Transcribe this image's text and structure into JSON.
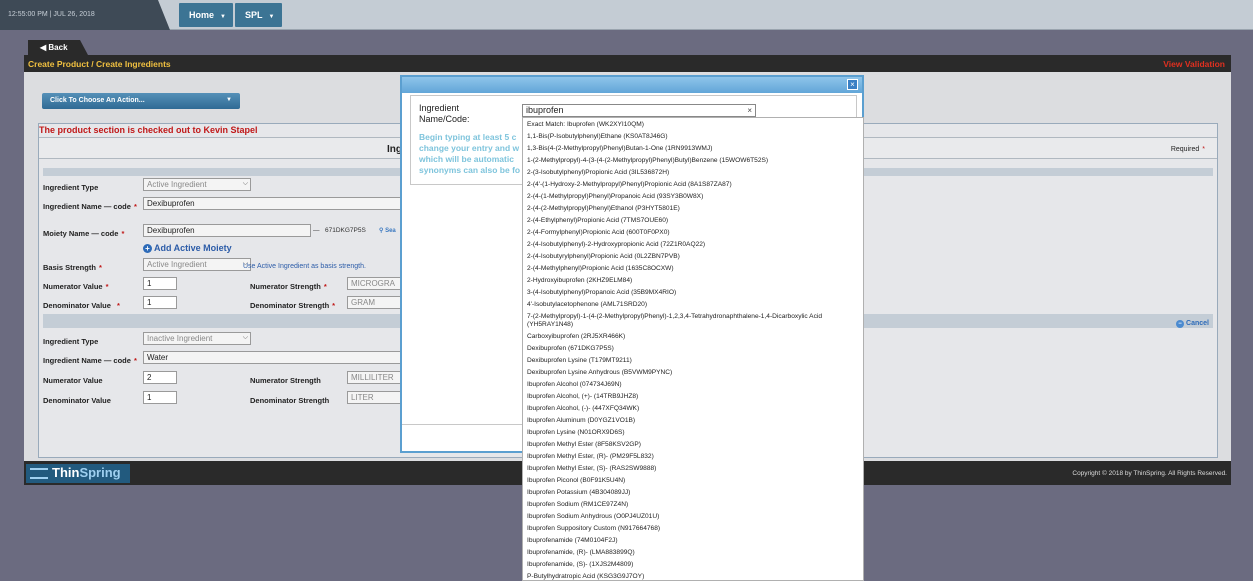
{
  "topbar": {
    "datetime": "12:55:00 PM | JUL 26, 2018",
    "nav": [
      {
        "label": "Home"
      },
      {
        "label": "SPL"
      }
    ]
  },
  "back_label": "Back",
  "breadcrumb": {
    "text": "Create Product  /  Create Ingredients"
  },
  "view_validation": "View Validation",
  "action_select": {
    "label": "Click To Choose An Action..."
  },
  "checked_out_msg": "The product section is checked out to Kevin Stapel",
  "form": {
    "title_fragment": "Ing",
    "required_label": "Required",
    "active": {
      "type_label": "Ingredient Type",
      "type_value": "Active Ingredient",
      "name_label": "Ingredient Name — code",
      "name_value": "Dexibuprofen",
      "moiety_label": "Moiety Name — code",
      "moiety_value": "Dexibuprofen",
      "moiety_code": "671DKG7P5S",
      "search_link": "Sea",
      "add_moiety": "Add Active Moiety",
      "basis_label": "Basis Strength",
      "basis_value": "Active Ingredient",
      "basis_note": "Use Active Ingredient as basis strength.",
      "num_value_label": "Numerator Value",
      "num_value": "1",
      "num_strength_label": "Numerator Strength",
      "num_strength": "MICROGRA",
      "den_value_label": "Denominator Value",
      "den_value": "1",
      "den_strength_label": "Denominator Strength",
      "den_strength": "GRAM"
    },
    "cancel_label": "Cancel",
    "inactive": {
      "type_label": "Ingredient Type",
      "type_value": "Inactive Ingredient",
      "name_label": "Ingredient Name — code",
      "name_value": "Water",
      "num_value_label": "Numerator Value",
      "num_value": "2",
      "num_strength_label": "Numerator Strength",
      "num_strength": "MILLILITER",
      "den_value_label": "Denominator Value",
      "den_value": "1",
      "den_strength_label": "Denominator Strength",
      "den_strength": "LITER"
    }
  },
  "footer": {
    "logo_thin": "Thin",
    "logo_spring": "Spring",
    "copyright": "Copyright © 2018 by ThinSpring. All Rights Reserved."
  },
  "modal": {
    "ingredient_label_1": "Ingredient",
    "ingredient_label_2": "Name/Code:",
    "hint_1": "Begin typing at least 5 c",
    "hint_2": "change your entry and w",
    "hint_3": "which will be automatic",
    "hint_4": "synonyms can also be fo",
    "search_value": "ibuprofen",
    "suggestions": [
      "Exact Match: Ibuprofen (WK2XYI10QM)",
      "1,1-Bis(P-Isobutylphenyl)Ethane (KS0AT8J46G)",
      "1,3-Bis(4-(2-Methylpropyl)Phenyl)Butan-1-One (1RN9913WMJ)",
      "1-(2-Methylpropyl)-4-(3-(4-(2-Methylpropyl)Phenyl)Butyl)Benzene (15WOW6T52S)",
      "2-(3-Isobutylphenyl)Propionic Acid (3IL536872H)",
      "2-(4'-(1-Hydroxy-2-Methylpropyl)Phenyl)Propionic Acid (8A1S87ZA87)",
      "2-(4-(1-Methylpropyl)Phenyl)Propanoic Acid (93SY3B0W8X)",
      "2-(4-(2-Methylpropyl)Phenyl)Ethanol (P3HYT5801E)",
      "2-(4-Ethylphenyl)Propionic Acid (7TMS7OUE60)",
      "2-(4-Formylphenyl)Propionic Acid (600T0F0PX0)",
      "2-(4-Isobutylphenyl)-2-Hydroxypropionic Acid (72Z1R0AQ22)",
      "2-(4-Isobutyrylphenyl)Propionic Acid (0L2ZBN7PVB)",
      "2-(4-Methylphenyl)Propionic Acid (1635C8OCXW)",
      "2-Hydroxyibuprofen (2KHZ9ELM84)",
      "3-(4-Isobutylphenyl)Propanoic Acid (35B9MX4RIO)",
      "4'-Isobutylacetophenone (AML71SRD20)",
      "7-(2-Methylpropyl)-1-(4-(2-Methylpropyl)Phenyl)-1,2,3,4-Tetrahydronaphthalene-1,4-Dicarboxylic Acid (YH5RAY1N48)",
      "Carboxyibuprofen (2RJ5XR466K)",
      "Dexibuprofen (671DKG7P5S)",
      "Dexibuprofen Lysine (T179MT9211)",
      "Dexibuprofen Lysine Anhydrous (B5VWM9PYNC)",
      "Ibuprofen Alcohol (074734J69N)",
      "Ibuprofen Alcohol, (+)- (14TRB9JHZ8)",
      "Ibuprofen Alcohol, (-)- (447XFQ34WK)",
      "Ibuprofen Aluminum (D0YGZ1VO1B)",
      "Ibuprofen Lysine (N01ORX9D6S)",
      "Ibuprofen Methyl Ester (8F58KSV2GP)",
      "Ibuprofen Methyl Ester, (R)- (PM29F5L832)",
      "Ibuprofen Methyl Ester, (S)- (RAS2SW9888)",
      "Ibuprofen Piconol (B0F91K5U4N)",
      "Ibuprofen Potassium (4B304089JJ)",
      "Ibuprofen Sodium (RM1CE97Z4N)",
      "Ibuprofen Sodium Anhydrous (O0PJ4UZ01U)",
      "Ibuprofen Suppository Custom (N917664768)",
      "Ibuprofenamide (74M0104F2J)",
      "Ibuprofenamide, (R)- (LMA883899Q)",
      "Ibuprofenamide, (S)- (1XJS2M4809)",
      "P-Butylhydratropic Acid (KSG3G9J7OY)"
    ]
  }
}
